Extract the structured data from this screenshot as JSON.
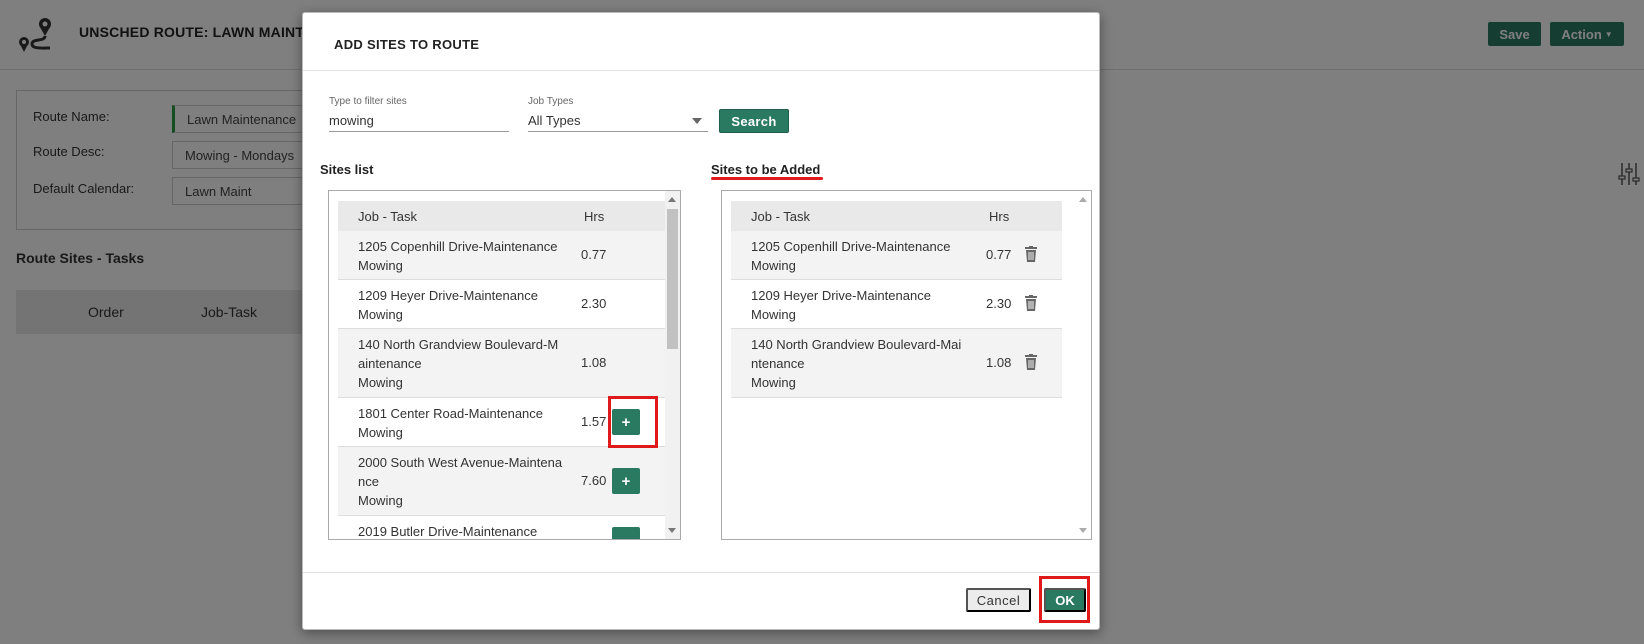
{
  "background": {
    "title": "UNSCHED ROUTE: LAWN MAINTE",
    "save_label": "Save",
    "action_label": "Action",
    "form": {
      "route_name_label": "Route Name:",
      "route_name_value": "Lawn Maintenance",
      "route_desc_label": "Route Desc:",
      "route_desc_value": "Mowing - Mondays",
      "default_calendar_label": "Default Calendar:",
      "default_calendar_value": "Lawn Maint"
    },
    "section_title": "Route Sites - Tasks",
    "table_headers": [
      "Order",
      "Job-Task"
    ]
  },
  "modal": {
    "title": "ADD SITES TO ROUTE",
    "filter": {
      "label": "Type to filter sites",
      "value": "mowing"
    },
    "job_types": {
      "label": "Job Types",
      "selected": "All Types"
    },
    "search_label": "Search",
    "sites_list": {
      "title": "Sites list",
      "headers": {
        "job": "Job - Task",
        "hrs": "Hrs"
      },
      "rows": [
        {
          "line1": "1205 Copenhill Drive-Maintenance",
          "line2": "Mowing",
          "line3": "",
          "hrs": "0.77",
          "add": ""
        },
        {
          "line1": "1209 Heyer Drive-Maintenance",
          "line2": "Mowing",
          "line3": "",
          "hrs": "2.30",
          "add": ""
        },
        {
          "line1": "140 North Grandview Boulevard-M",
          "line2": "aintenance",
          "line3": "Mowing",
          "hrs": "1.08",
          "add": ""
        },
        {
          "line1": "1801 Center Road-Maintenance",
          "line2": "Mowing",
          "line3": "",
          "hrs": "1.57",
          "add": "+"
        },
        {
          "line1": "2000 South West Avenue-Maintena",
          "line2": "nce",
          "line3": "Mowing",
          "hrs": "7.60",
          "add": "+"
        },
        {
          "line1": "2019 Butler Drive-Maintenance",
          "line2": "",
          "line3": "",
          "hrs": "",
          "add": ""
        }
      ]
    },
    "sites_added": {
      "title": "Sites to be Added",
      "headers": {
        "job": "Job - Task",
        "hrs": "Hrs"
      },
      "rows": [
        {
          "line1": "1205 Copenhill Drive-Maintenance",
          "line2": "Mowing",
          "line3": "",
          "hrs": "0.77"
        },
        {
          "line1": "1209 Heyer Drive-Maintenance",
          "line2": "Mowing",
          "line3": "",
          "hrs": "2.30"
        },
        {
          "line1": "140 North Grandview Boulevard-Mai",
          "line2": "ntenance",
          "line3": "Mowing",
          "hrs": "1.08"
        }
      ]
    },
    "cancel_label": "Cancel",
    "ok_label": "OK"
  },
  "colors": {
    "primary_green": "#2a7a62",
    "highlight_red": "#e0191b",
    "accent_green": "#2a9d46"
  },
  "icons": [
    "route-logo-icon",
    "sliders-icon",
    "trash-icon",
    "plus-icon",
    "caret-down-icon"
  ]
}
